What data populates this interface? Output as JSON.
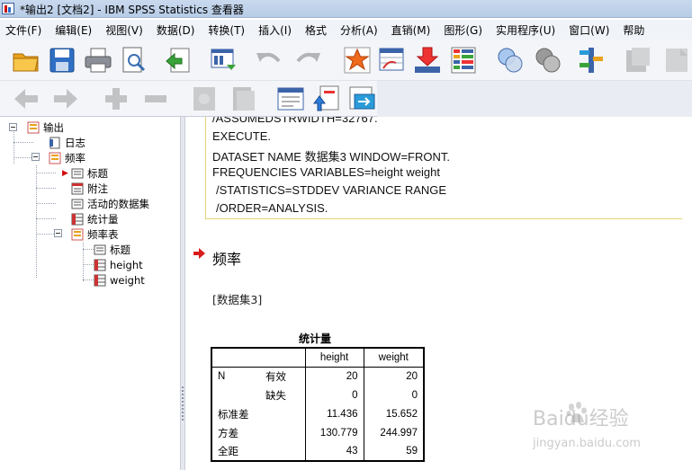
{
  "window": {
    "title": "*输出2 [文档2] - IBM SPSS Statistics 查看器"
  },
  "menu": [
    {
      "label": "文件(F)"
    },
    {
      "label": "编辑(E)"
    },
    {
      "label": "视图(V)"
    },
    {
      "label": "数据(D)"
    },
    {
      "label": "转换(T)"
    },
    {
      "label": "插入(I)"
    },
    {
      "label": "格式"
    },
    {
      "label": "分析(A)"
    },
    {
      "label": "直销(M)"
    },
    {
      "label": "图形(G)"
    },
    {
      "label": "实用程序(U)"
    },
    {
      "label": "窗口(W)"
    },
    {
      "label": "帮助"
    }
  ],
  "toolbar": {
    "row1": [
      "open-folder-icon",
      "save-icon",
      "print-icon",
      "print-preview-icon",
      "export-icon",
      "recall-dialog-icon",
      "undo-icon",
      "redo-icon",
      "goto-data-icon",
      "goto-case-icon",
      "goto-variable-icon",
      "variables-icon",
      "show-all-icon",
      "hide-icon",
      "designate-window-icon",
      "insert-output-icon",
      "insert-text-icon"
    ],
    "row2": [
      "promote-icon",
      "demote-icon",
      "expand-icon",
      "collapse-icon",
      "show-icon",
      "hide-block-icon",
      "insert-heading-icon",
      "insert-title-icon",
      "insert-textbox-icon"
    ]
  },
  "outline": {
    "nodes": [
      {
        "label": "输出",
        "icon": "output-icon",
        "level": 0
      },
      {
        "label": "日志",
        "icon": "log-icon",
        "level": 1
      },
      {
        "label": "频率",
        "icon": "procedure-icon",
        "level": 1
      },
      {
        "label": "标题",
        "icon": "title-icon",
        "level": 2,
        "selected": true
      },
      {
        "label": "附注",
        "icon": "notes-icon",
        "level": 2
      },
      {
        "label": "活动的数据集",
        "icon": "dataset-icon",
        "level": 2
      },
      {
        "label": "统计量",
        "icon": "table-icon",
        "level": 2
      },
      {
        "label": "频率表",
        "icon": "procedure-icon",
        "level": 2
      },
      {
        "label": "标题",
        "icon": "title-icon",
        "level": 3
      },
      {
        "label": "height",
        "icon": "table-icon",
        "level": 3
      },
      {
        "label": "weight",
        "icon": "table-icon",
        "level": 3
      }
    ]
  },
  "syntax": {
    "lines": [
      "/ASSUMEDSTRWIDTH=32767.",
      "EXECUTE.",
      "DATASET NAME 数据集3 WINDOW=FRONT.",
      "FREQUENCIES VARIABLES=height weight",
      "  /STATISTICS=STDDEV VARIANCE RANGE",
      "  /ORDER=ANALYSIS."
    ]
  },
  "section": {
    "title": "频率",
    "dataset": "[数据集3]"
  },
  "stats_table": {
    "title": "统计量",
    "headers": [
      "height",
      "weight"
    ],
    "rows": [
      {
        "label": "N",
        "sub": "有效",
        "height": "20",
        "weight": "20"
      },
      {
        "label": "",
        "sub": "缺失",
        "height": "0",
        "weight": "0"
      },
      {
        "label": "标准差",
        "sub": "",
        "height": "11.436",
        "weight": "15.652"
      },
      {
        "label": "方差",
        "sub": "",
        "height": "130.779",
        "weight": "244.997"
      },
      {
        "label": "全距",
        "sub": "",
        "height": "43",
        "weight": "59"
      }
    ]
  },
  "watermark": {
    "brand": "Baidu经验",
    "url": "jingyan.baidu.com"
  }
}
